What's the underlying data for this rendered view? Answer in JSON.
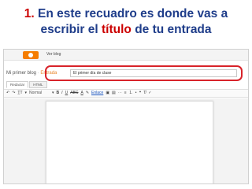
{
  "caption": {
    "number": "1.",
    "line1_rest": "En este recuadro es donde vas a",
    "line2_before": "escribir el",
    "line2_highlight": "título",
    "line2_after": "de tu entrada"
  },
  "colors": {
    "caption_text": "#1f3d8a",
    "caption_highlight": "#cc0000",
    "annotation_box": "#d8232a",
    "blogger_orange": "#f57d00"
  },
  "screenshot": {
    "topbar": {
      "link_label": "Ver blog",
      "logo_icon": "blogger-logo-icon"
    },
    "header": {
      "blog_name": "Mi primer blog",
      "separator": "·",
      "entry_label": "Entrada"
    },
    "title_field": {
      "value": "El primer día de clase"
    },
    "modes": [
      "Redactar",
      "HTML"
    ],
    "toolbar": {
      "undo": "↶",
      "redo": "↷",
      "font_size": "T̲T",
      "format": "Normal",
      "dropdown": "▾",
      "bold": "B",
      "italic": "I",
      "underline": "U",
      "strike": "ABC",
      "text_color": "A",
      "highlight": "✎",
      "link": "Enlace",
      "image": "▣",
      "video": "▤",
      "jump": "⋯",
      "align": "≡",
      "list_num": "⒈",
      "list_bul": "•",
      "quote": "❝",
      "clear": "T̸",
      "spell": "✓"
    }
  }
}
